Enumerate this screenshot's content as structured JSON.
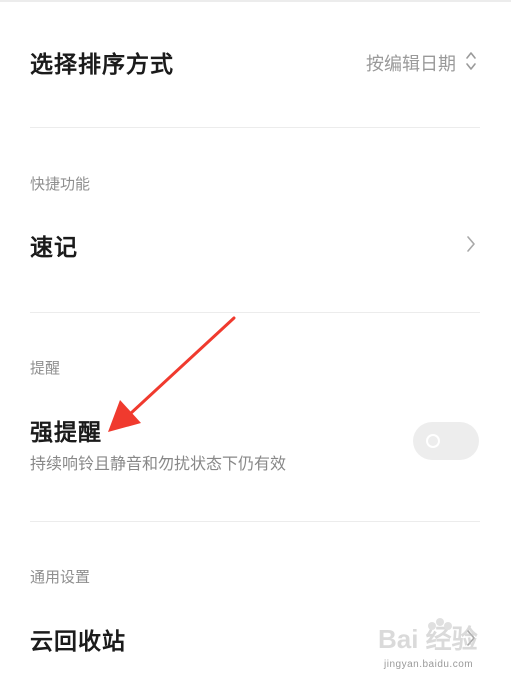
{
  "sort": {
    "label": "选择排序方式",
    "value": "按编辑日期",
    "icon": "sort-updown-icon"
  },
  "shortcuts": {
    "section_label": "快捷功能",
    "items": [
      {
        "label": "速记",
        "icon": "chevron-right-icon"
      }
    ]
  },
  "reminder": {
    "section_label": "提醒",
    "strong_reminder": {
      "label": "强提醒",
      "description": "持续响铃且静音和勿扰状态下仍有效",
      "toggle_on": false
    }
  },
  "general": {
    "section_label": "通用设置",
    "items": [
      {
        "label": "云回收站",
        "icon": "chevron-right-icon"
      }
    ]
  },
  "annotation": {
    "arrow_color": "#f03a2e"
  },
  "watermark": {
    "brand": "Bai 经验",
    "url": "jingyan.baidu.com"
  }
}
